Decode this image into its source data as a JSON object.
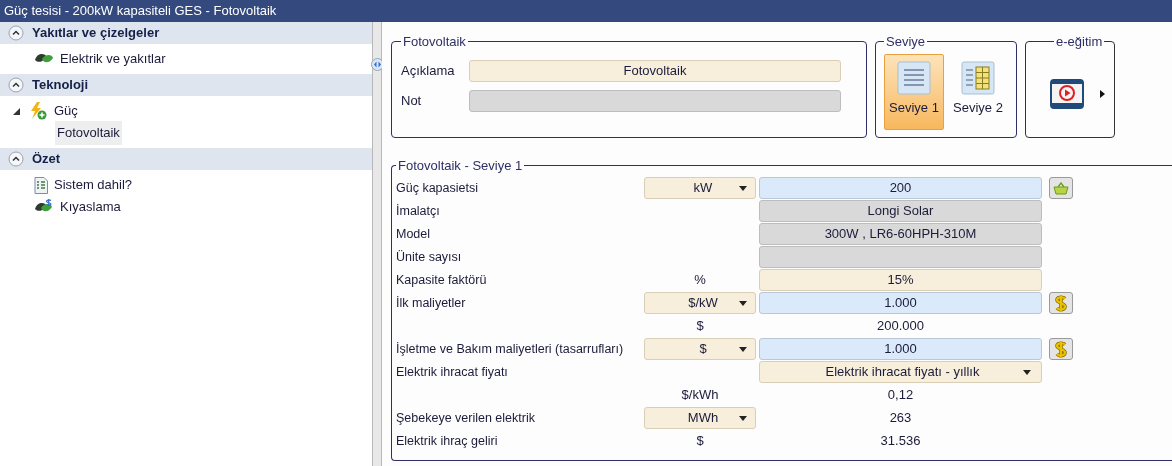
{
  "window": {
    "title": "Güç tesisi - 200kW kapasiteli GES - Fotovoltaik"
  },
  "sidebar": {
    "sections": [
      {
        "title": "Yakıtlar ve çizelgeler",
        "expanded": true,
        "items": [
          {
            "kind": "fuel",
            "label": "Elektrik ve yakıtlar"
          }
        ]
      },
      {
        "title": "Teknoloji",
        "expanded": true,
        "items": [
          {
            "kind": "power",
            "label": "Güç",
            "expanded": true,
            "children": [
              {
                "label": "Fotovoltaik",
                "selected": true
              }
            ]
          }
        ]
      },
      {
        "title": "Özet",
        "expanded": true,
        "items": [
          {
            "kind": "report",
            "label": "Sistem dahil?"
          },
          {
            "kind": "benchmark",
            "label": "Kıyaslama"
          }
        ]
      }
    ]
  },
  "description_group": {
    "title": "Fotovoltaik",
    "fields": [
      {
        "label": "Açıklama",
        "value": "Fotovoltaik",
        "kind": "entry"
      },
      {
        "label": "Not",
        "kind": "locked"
      }
    ]
  },
  "level_group": {
    "title": "Seviye",
    "options": [
      {
        "label": "Seviye 1",
        "kind": "lines",
        "selected": true
      },
      {
        "label": "Seviye 2",
        "kind": "grid",
        "selected": false
      }
    ]
  },
  "training_group": {
    "title": "e-eğitim"
  },
  "details_group": {
    "title": "Fotovoltaik - Seviye 1",
    "rows": [
      {
        "label": "Güç kapasietsi",
        "unit": {
          "kind": "select",
          "text": "kW"
        },
        "value": {
          "kind": "input",
          "text": "200"
        },
        "action": {
          "kind": "basket"
        }
      },
      {
        "label": "İmalatçı",
        "value": {
          "kind": "locked",
          "text": "Longi Solar"
        }
      },
      {
        "label": "Model",
        "value": {
          "kind": "locked",
          "text": "300W , LR6-60HPH-310M"
        }
      },
      {
        "label": "Ünite sayısı",
        "value": {
          "kind": "locked"
        }
      },
      {
        "label": "Kapasite faktörü",
        "unit": {
          "kind": "text",
          "text": "%"
        },
        "value": {
          "kind": "entry",
          "text": "15%"
        }
      },
      {
        "label": "İlk maliyetler",
        "unit": {
          "kind": "select",
          "text": "$/kW"
        },
        "value": {
          "kind": "input",
          "text": "1.000"
        },
        "action": {
          "kind": "dollar"
        }
      },
      {
        "unit": {
          "kind": "text",
          "text": "$"
        },
        "value": {
          "kind": "output",
          "text": "200.000"
        }
      },
      {
        "label": "İşletme ve Bakım maliyetleri (tasarrufları)",
        "unit": {
          "kind": "select",
          "text": "$"
        },
        "value": {
          "kind": "input",
          "text": "1.000"
        },
        "action": {
          "kind": "dollar"
        }
      },
      {
        "label": "Elektrik ihracat fiyatı",
        "value": {
          "kind": "select",
          "text": "Elektrik ihracat fiyatı - yıllık"
        }
      },
      {
        "unit": {
          "kind": "text",
          "text": "$/kWh"
        },
        "value": {
          "kind": "output",
          "text": "0,12"
        }
      },
      {
        "label": "Şebekeye verilen elektrik",
        "unit": {
          "kind": "select",
          "text": "MWh"
        },
        "value": {
          "kind": "output",
          "text": "263"
        }
      },
      {
        "label": "Elektrik ihraç geliri",
        "unit": {
          "kind": "text",
          "text": "$"
        },
        "value": {
          "kind": "output",
          "text": "31.536"
        }
      }
    ]
  }
}
